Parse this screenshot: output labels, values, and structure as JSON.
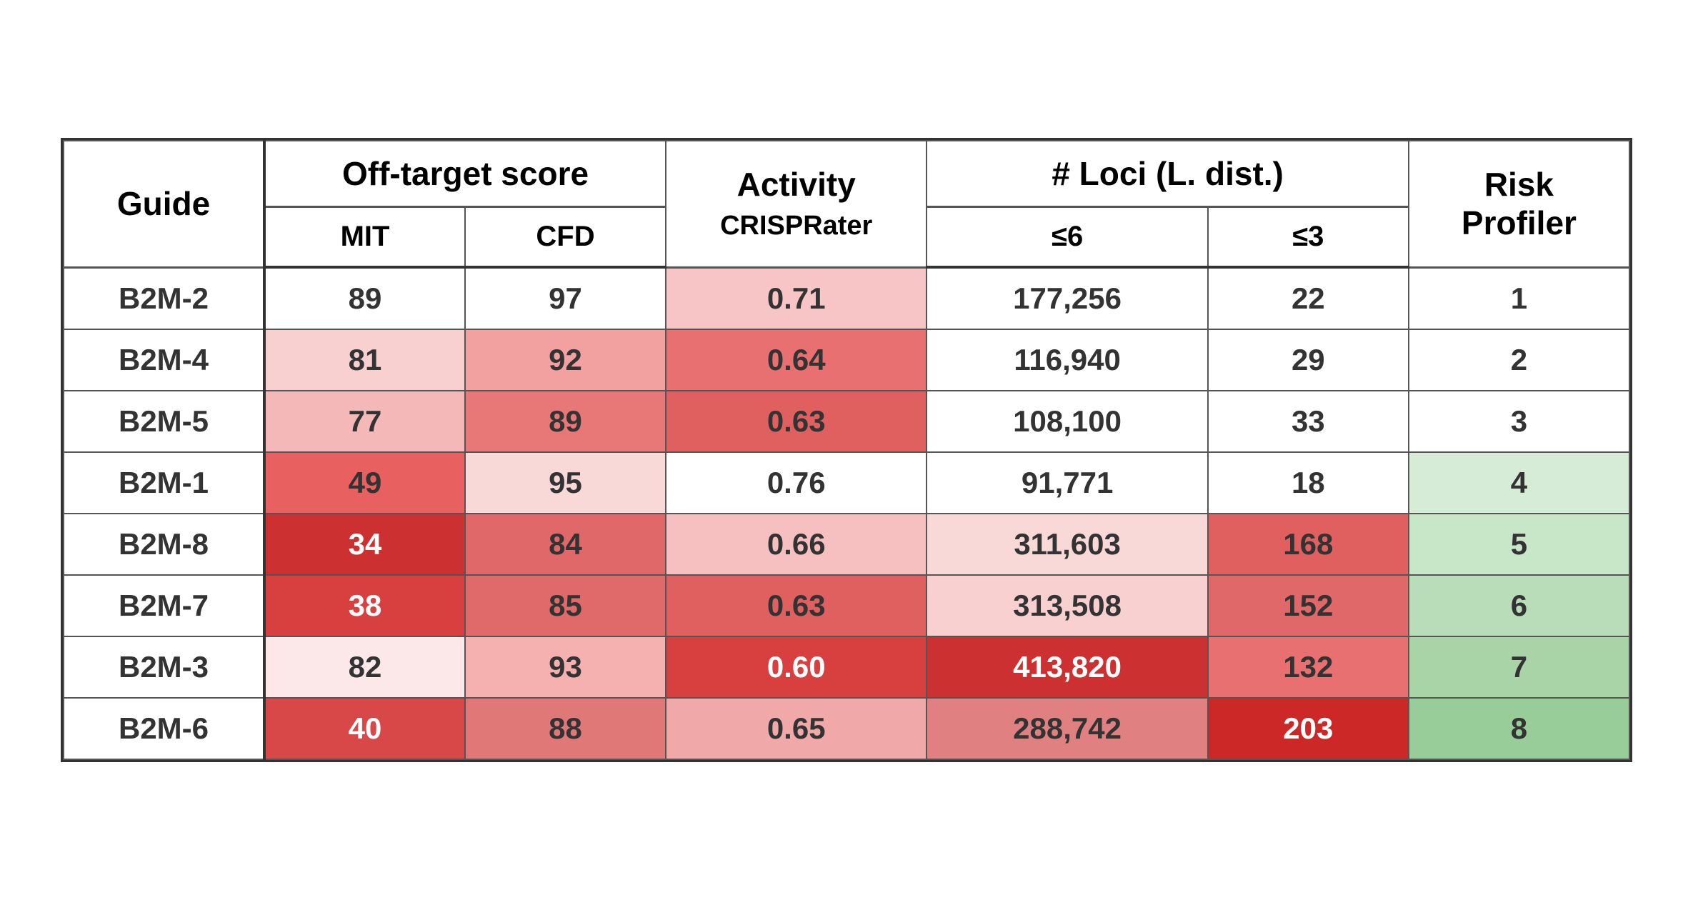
{
  "table": {
    "headers": {
      "guide": "Guide",
      "off_target_score": "Off-target score",
      "activity": "Activity",
      "loci": "# Loci (L. dist.)",
      "risk_profiler": "Risk\nProfiler",
      "mit": "MIT",
      "cfd": "CFD",
      "crisprater": "CRISPRater",
      "loci_6": "≤6",
      "loci_3": "≤3"
    },
    "rows": [
      {
        "guide": "B2M-2",
        "mit": "89",
        "cfd": "97",
        "crisprater": "0.71",
        "loci_6": "177,256",
        "loci_3": "22",
        "risk": "1",
        "mit_color": "#ffffff",
        "cfd_color": "#ffffff",
        "crisprater_color": "#f7c5c5",
        "loci6_color": "#ffffff",
        "loci3_color": "#ffffff",
        "risk_color": "#ffffff"
      },
      {
        "guide": "B2M-4",
        "mit": "81",
        "cfd": "92",
        "crisprater": "0.64",
        "loci_6": "116,940",
        "loci_3": "29",
        "risk": "2",
        "mit_color": "#f9d0d0",
        "cfd_color": "#f2a0a0",
        "crisprater_color": "#e87070",
        "loci6_color": "#ffffff",
        "loci3_color": "#ffffff",
        "risk_color": "#ffffff"
      },
      {
        "guide": "B2M-5",
        "mit": "77",
        "cfd": "89",
        "crisprater": "0.63",
        "loci_6": "108,100",
        "loci_3": "33",
        "risk": "3",
        "mit_color": "#f5b8b8",
        "cfd_color": "#e87878",
        "crisprater_color": "#e06060",
        "loci6_color": "#ffffff",
        "loci3_color": "#ffffff",
        "risk_color": "#ffffff"
      },
      {
        "guide": "B2M-1",
        "mit": "49",
        "cfd": "95",
        "crisprater": "0.76",
        "loci_6": "91,771",
        "loci_3": "18",
        "risk": "4",
        "mit_color": "#e86060",
        "cfd_color": "#f9d8d8",
        "crisprater_color": "#ffffff",
        "loci6_color": "#ffffff",
        "loci3_color": "#ffffff",
        "risk_color": "#d6ecd6"
      },
      {
        "guide": "B2M-8",
        "mit": "34",
        "cfd": "84",
        "crisprater": "0.66",
        "loci_6": "311,603",
        "loci_3": "168",
        "risk": "5",
        "mit_color": "#cc3030",
        "cfd_color": "#e06868",
        "crisprater_color": "#f7c0c0",
        "loci6_color": "#f9d8d8",
        "loci3_color": "#e06060",
        "risk_color": "#c8e6c8"
      },
      {
        "guide": "B2M-7",
        "mit": "38",
        "cfd": "85",
        "crisprater": "0.63",
        "loci_6": "313,508",
        "loci_3": "152",
        "risk": "6",
        "mit_color": "#d84040",
        "cfd_color": "#e06a6a",
        "crisprater_color": "#e06060",
        "loci6_color": "#f8d0d0",
        "loci3_color": "#e06868",
        "risk_color": "#b8ddb8"
      },
      {
        "guide": "B2M-3",
        "mit": "82",
        "cfd": "93",
        "crisprater": "0.60",
        "loci_6": "413,820",
        "loci_3": "132",
        "risk": "7",
        "mit_color": "#fce8e8",
        "cfd_color": "#f5b0b0",
        "crisprater_color": "#d84040",
        "loci6_color": "#cc3030",
        "loci3_color": "#e87070",
        "risk_color": "#a8d4a8"
      },
      {
        "guide": "B2M-6",
        "mit": "40",
        "cfd": "88",
        "crisprater": "0.65",
        "loci_6": "288,742",
        "loci_3": "203",
        "risk": "8",
        "mit_color": "#d84848",
        "cfd_color": "#e07878",
        "crisprater_color": "#f0a8a8",
        "loci6_color": "#e08080",
        "loci3_color": "#cc2828",
        "risk_color": "#98cc98"
      }
    ]
  }
}
